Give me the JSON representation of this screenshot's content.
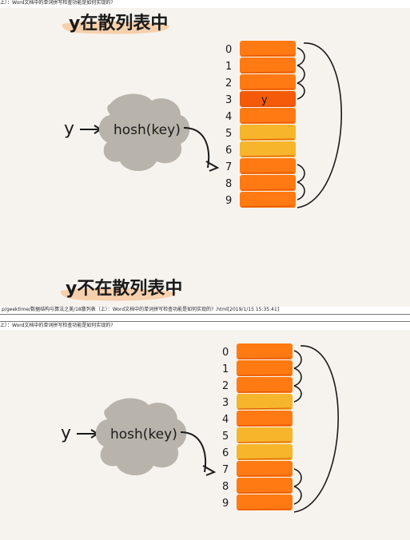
{
  "captions": {
    "top": "上）：Word文档中的单词拼写检查功能是如何实现的?",
    "middle": "p/geektime/数据结构与算法之美/18散列表（上）：Word文档中的单词拼写检查功能是如何实现的? .html[2019/1/15 15:35:41]",
    "bottom": "上）：Word文档中的单词拼写检查功能是如何实现的?"
  },
  "titles": {
    "in_table": "y在散列表中",
    "not_in_table": "y不在散列表中"
  },
  "diagram": {
    "input_label": "y",
    "hash_label": "hosh(key)",
    "slot_indices": [
      "0",
      "1",
      "2",
      "3",
      "4",
      "5",
      "6",
      "7",
      "8",
      "9"
    ],
    "stored_value": "y",
    "stored_slot": 3
  },
  "colors": {
    "orange": "#ff7a12",
    "dark_orange": "#f45a08",
    "yellow": "#f6b52a",
    "cloud": "#b9b4ab",
    "highlight": "#f6c9a0"
  },
  "panel_1_slot_fill": [
    "orange",
    "orange",
    "orange",
    "dark_orange",
    "orange",
    "yellow",
    "yellow",
    "orange",
    "orange",
    "orange"
  ],
  "panel_2_slot_fill": [
    "orange",
    "orange",
    "orange",
    "yellow",
    "orange",
    "yellow",
    "yellow",
    "orange",
    "orange",
    "orange"
  ]
}
